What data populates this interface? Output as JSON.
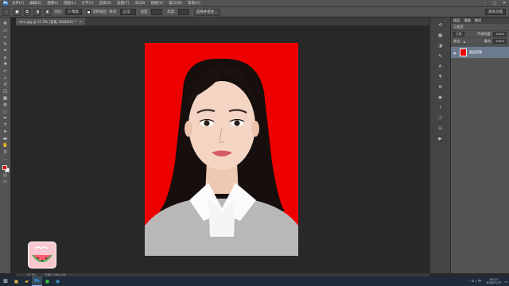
{
  "menubar": {
    "logo": "Ps",
    "items": [
      "文件(F)",
      "编辑(E)",
      "图像(I)",
      "图层(L)",
      "文字(Y)",
      "选择(S)",
      "滤镜(T)",
      "3D(D)",
      "视图(V)",
      "窗口(W)",
      "帮助(H)"
    ],
    "window_controls": [
      "–",
      "▢",
      "✕"
    ]
  },
  "options": {
    "feather_label": "羽化:",
    "feather_value": "0 像素",
    "style_label": "样式:",
    "style_value": "正常",
    "width_label": "宽度:",
    "height_label": "高度:",
    "antialias_label": "消除锯齿",
    "refine_button": "选择并遮住...",
    "extra_select": "基本功能"
  },
  "document": {
    "tab_title": "mm.jpg @ 37.5% (背景, RGB/8#) *",
    "tab_close": "×",
    "zoom": "37.5%",
    "doc_info": "文档:4.5M/4.5M"
  },
  "tools": [
    {
      "name": "move-tool",
      "glyph": "✥"
    },
    {
      "name": "marquee-tool",
      "glyph": "▭"
    },
    {
      "name": "lasso-tool",
      "glyph": "ↄ"
    },
    {
      "name": "quick-select-tool",
      "glyph": "✎"
    },
    {
      "name": "crop-tool",
      "glyph": "⌗"
    },
    {
      "name": "eyedropper-tool",
      "glyph": "⌀"
    },
    {
      "name": "healing-tool",
      "glyph": "✚"
    },
    {
      "name": "brush-tool",
      "glyph": "✏"
    },
    {
      "name": "clone-stamp-tool",
      "glyph": "⊥"
    },
    {
      "name": "history-brush-tool",
      "glyph": "↺"
    },
    {
      "name": "eraser-tool",
      "glyph": "◫"
    },
    {
      "name": "gradient-tool",
      "glyph": "▦"
    },
    {
      "name": "blur-tool",
      "glyph": "◍"
    },
    {
      "name": "dodge-tool",
      "glyph": "○"
    },
    {
      "name": "pen-tool",
      "glyph": "✒"
    },
    {
      "name": "type-tool",
      "glyph": "T"
    },
    {
      "name": "path-select-tool",
      "glyph": "➤"
    },
    {
      "name": "shape-tool",
      "glyph": "▬"
    },
    {
      "name": "hand-tool",
      "glyph": "✋"
    },
    {
      "name": "zoom-tool",
      "glyph": "⚲"
    },
    {
      "name": "more-tools",
      "glyph": "…"
    }
  ],
  "colors": {
    "foreground": "#e00000",
    "background": "#ffffff",
    "photo_background": "#ef0000",
    "ui_panel": "#535353",
    "canvas": "#282828"
  },
  "dock_icons": [
    "history-icon",
    "swatches-icon",
    "adjustments-icon",
    "brush-settings-icon",
    "character-icon",
    "paragraph-icon",
    "properties-icon",
    "channels-icon",
    "paths-icon",
    "info-icon",
    "navigator-icon",
    "actions-icon"
  ],
  "layers_panel": {
    "tabs": [
      "图层",
      "通道",
      "路径"
    ],
    "kind_label": "Ｑ类型",
    "blend_mode": "正常",
    "opacity_label": "不透明度:",
    "opacity_value": "100%",
    "lock_label": "锁定:",
    "fill_label": "填充:",
    "fill_value": "100%",
    "layer_name": "图层背景"
  },
  "taskbar": {
    "start_glyph": "⊞",
    "apps": [
      "file-explorer-icon",
      "folder-icon",
      "photoshop-icon",
      "wechat-icon",
      "browser-icon"
    ],
    "time": "10:27",
    "date": "2018/7/27",
    "tray": "^ ⊡ ♪ 中"
  }
}
